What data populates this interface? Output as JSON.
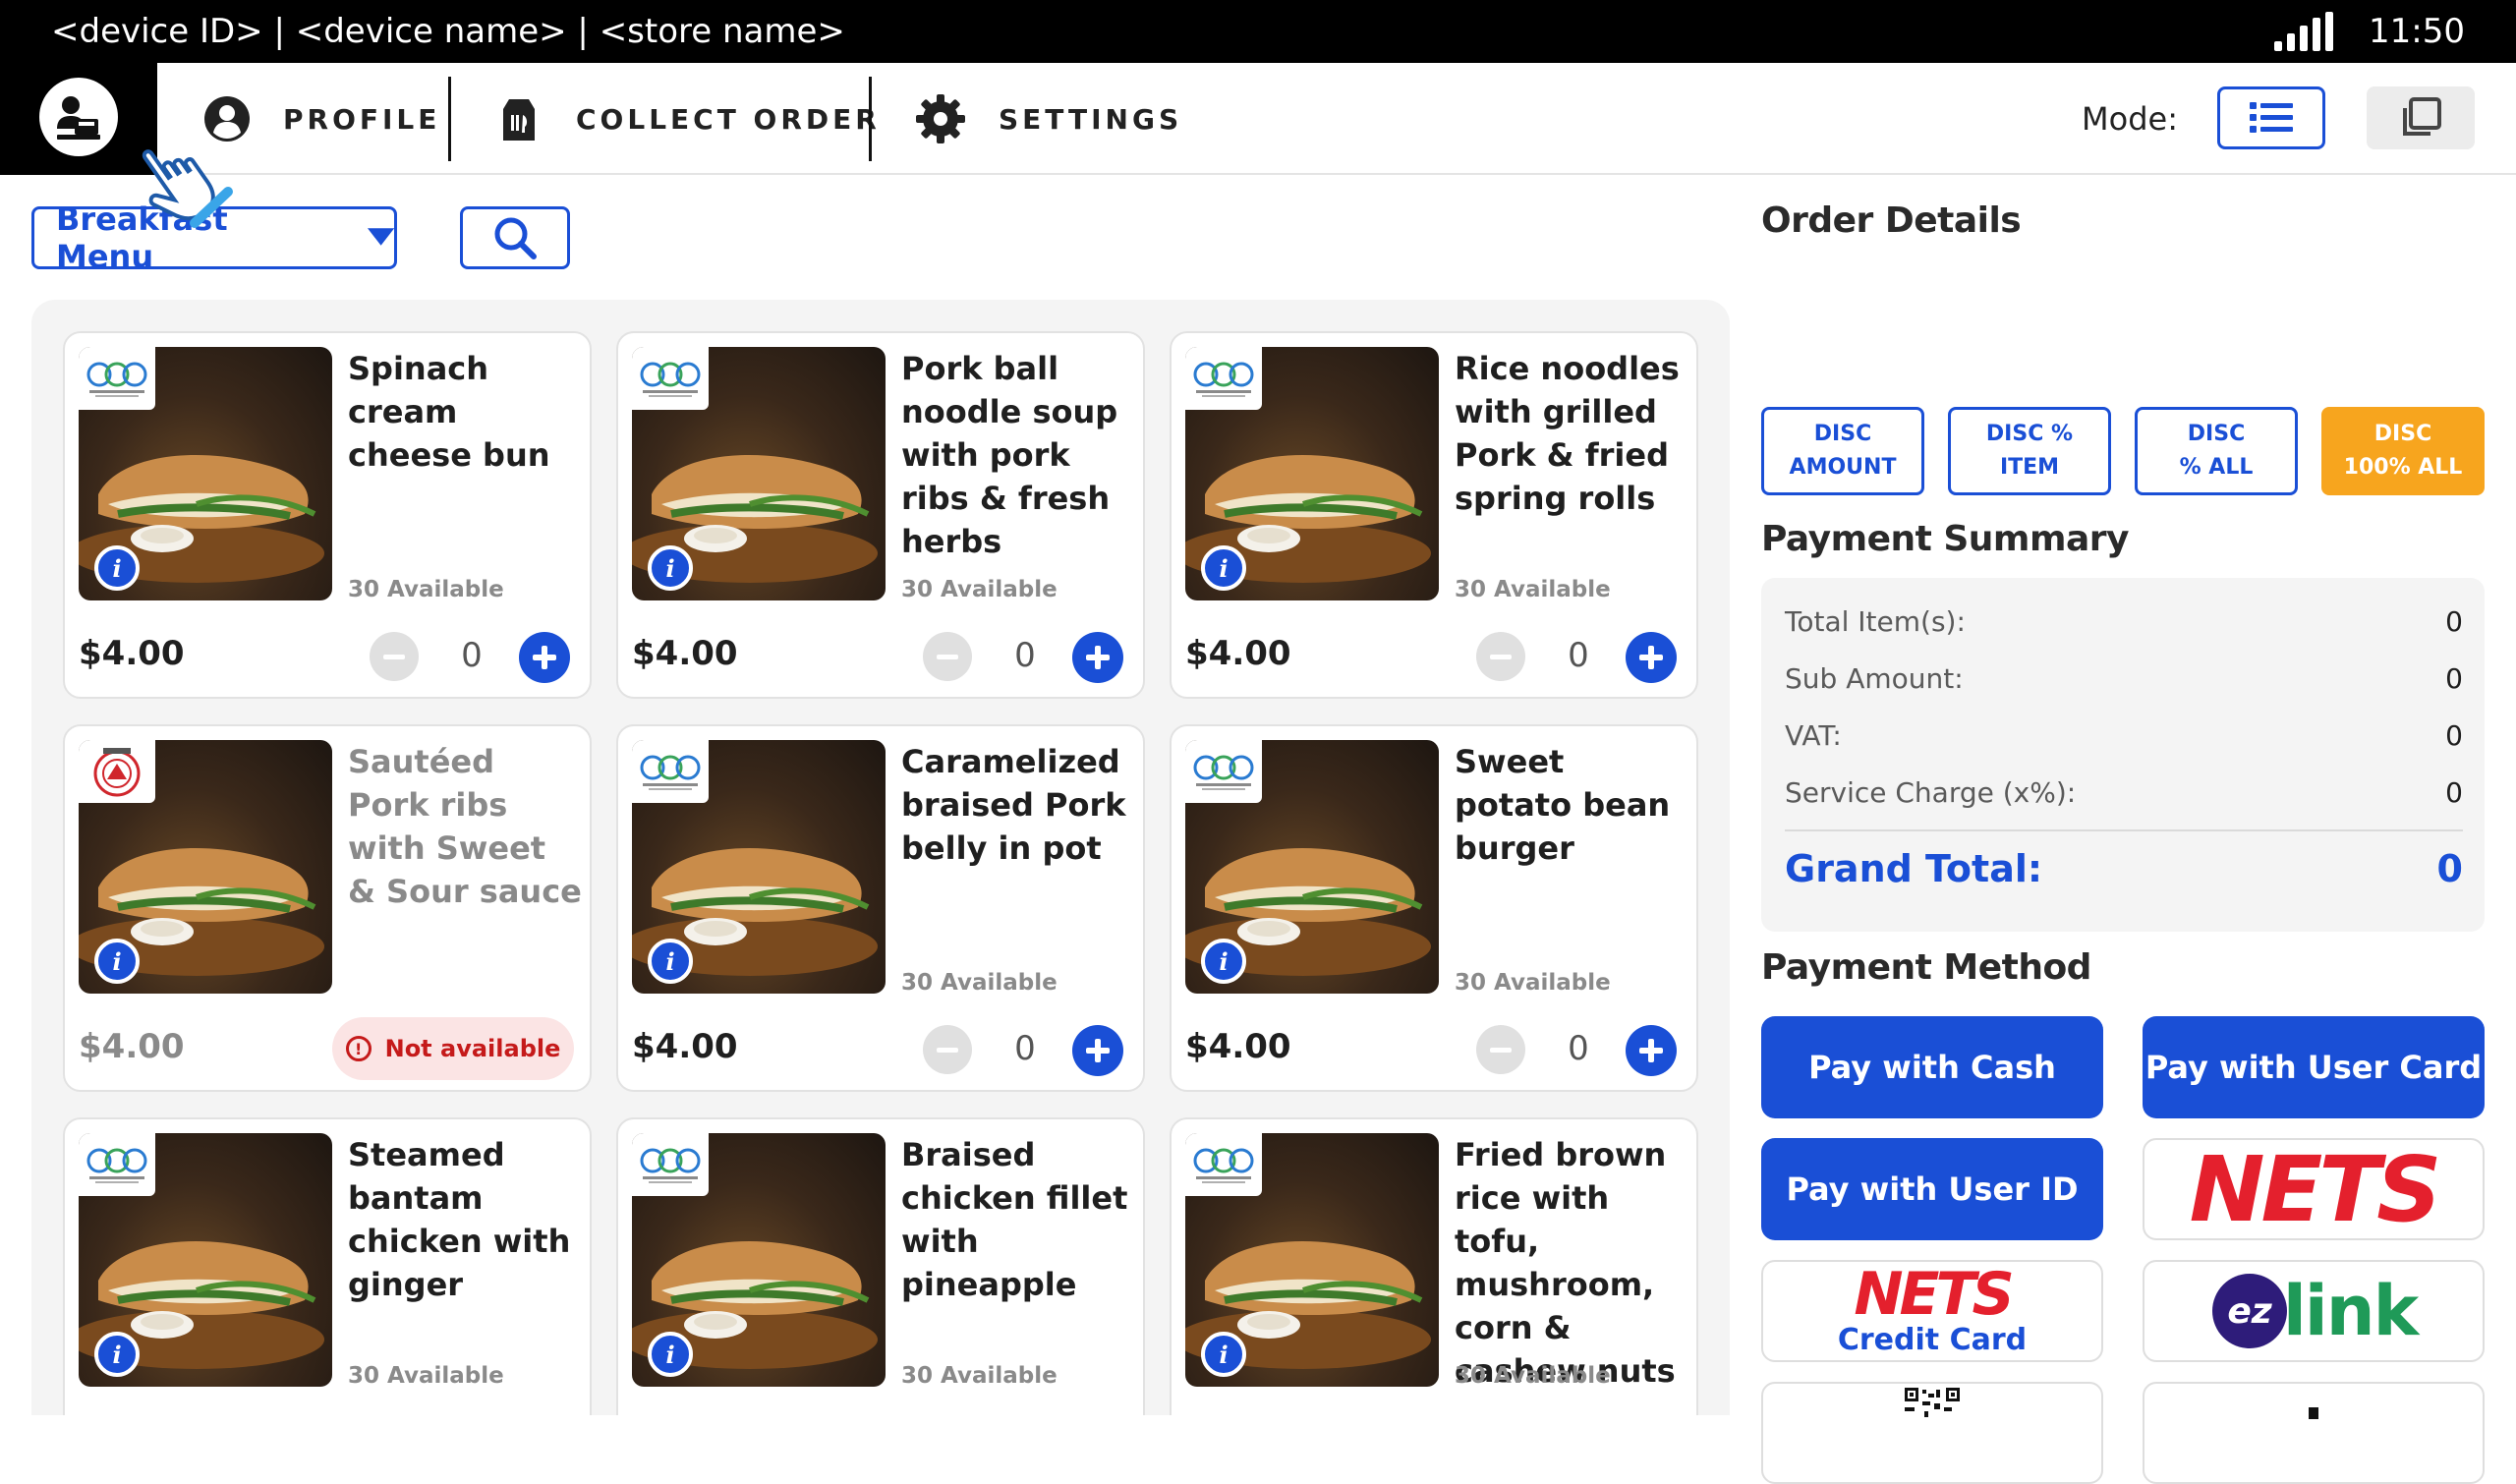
{
  "status_bar": {
    "device_text": "<device ID> | <device name> | <store name>",
    "time": "11:50"
  },
  "nav": {
    "home_icon": "cashier-icon",
    "items": [
      {
        "label": "PROFILE",
        "icon": "user-circle-icon"
      },
      {
        "label": "COLLECT ORDER",
        "icon": "food-bag-icon"
      },
      {
        "label": "SETTINGS",
        "icon": "gear-icon"
      }
    ],
    "mode_label": "Mode:",
    "mode_options": [
      "list-view-icon",
      "grid-view-icon"
    ],
    "active_mode": "list-view-icon"
  },
  "toolbar": {
    "menu_selected": "Breakfast Menu"
  },
  "products": [
    {
      "name": "Spinach cream cheese bun",
      "availability": "30 Available",
      "price": "$4.00",
      "qty": "0",
      "available": true,
      "logo": "store-logo"
    },
    {
      "name": "Pork ball noodle soup with pork ribs & fresh herbs",
      "availability": "30 Available",
      "price": "$4.00",
      "qty": "0",
      "available": true,
      "logo": "store-logo"
    },
    {
      "name": "Rice noodles with grilled Pork & fried spring rolls",
      "availability": "30 Available",
      "price": "$4.00",
      "qty": "0",
      "available": true,
      "logo": "store-logo"
    },
    {
      "name": "Sautéed Pork ribs with Sweet & Sour sauce",
      "availability": "",
      "price": "$4.00",
      "qty": "",
      "available": false,
      "status": "Not available",
      "logo": "no-added-sugar-logo"
    },
    {
      "name": "Caramelized braised Pork belly in pot",
      "availability": "30 Available",
      "price": "$4.00",
      "qty": "0",
      "available": true,
      "logo": "store-logo"
    },
    {
      "name": "Sweet potato bean burger",
      "availability": "30 Available",
      "price": "$4.00",
      "qty": "0",
      "available": true,
      "logo": "store-logo"
    },
    {
      "name": "Steamed bantam chicken with ginger",
      "availability": "30 Available",
      "price": "",
      "qty": "",
      "available": true,
      "logo": "store-logo"
    },
    {
      "name": "Braised chicken fillet with pineapple",
      "availability": "30 Available",
      "price": "",
      "qty": "",
      "available": true,
      "logo": "store-logo"
    },
    {
      "name": "Fried brown rice with tofu, mushroom, corn & cashew nuts",
      "availability": "30 Available",
      "price": "",
      "qty": "",
      "available": true,
      "logo": "store-logo"
    }
  ],
  "order_details": {
    "title": "Order Details"
  },
  "discounts": [
    {
      "line1": "DISC",
      "line2": "AMOUNT",
      "active": false
    },
    {
      "line1": "DISC %",
      "line2": "ITEM",
      "active": false
    },
    {
      "line1": "DISC",
      "line2": "% ALL",
      "active": false
    },
    {
      "line1": "DISC",
      "line2": "100% ALL",
      "active": true
    }
  ],
  "payment_summary": {
    "title": "Payment Summary",
    "rows": [
      {
        "label": "Total Item(s):",
        "value": "0"
      },
      {
        "label": "Sub Amount:",
        "value": "0"
      },
      {
        "label": "VAT:",
        "value": "0"
      },
      {
        "label": "Service Charge (x%):",
        "value": "0"
      }
    ],
    "grand_total_label": "Grand Total:",
    "grand_total_value": "0"
  },
  "payment_method": {
    "title": "Payment Method",
    "buttons": [
      "Pay with Cash",
      "Pay with User Card",
      "Pay with User ID"
    ],
    "nets_logo_text": "NETS",
    "credit_card_logo_text": "NETS",
    "credit_card_caption": "Credit Card",
    "ezlink_logo_text": "ezlink"
  },
  "colors": {
    "primary": "#1a4fd6",
    "accent_orange": "#f7a51e",
    "danger": "#c51a1a",
    "nets_red": "#e4202d",
    "nets_blue": "#1e3a8a",
    "ezlink_purple": "#2e1c7a",
    "ezlink_green": "#1f9a58"
  }
}
